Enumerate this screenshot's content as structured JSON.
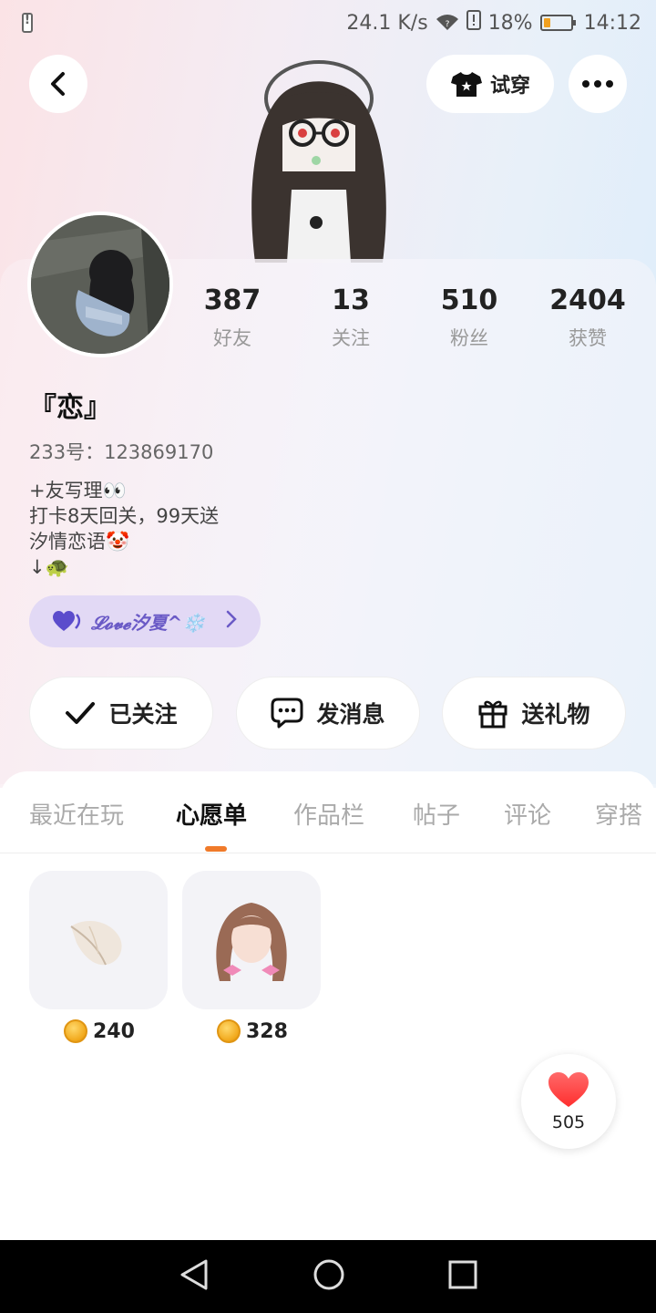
{
  "status_bar": {
    "net_speed": "24.1 K/s",
    "battery_percent": "18%",
    "time": "14:12"
  },
  "header": {
    "try_on_label": "试穿"
  },
  "profile": {
    "stats": [
      {
        "value": "387",
        "label": "好友"
      },
      {
        "value": "13",
        "label": "关注"
      },
      {
        "value": "510",
        "label": "粉丝"
      },
      {
        "value": "2404",
        "label": "获赞"
      }
    ],
    "nickname": "『恋』",
    "uid": "233号：123869170",
    "bio": [
      "+友写理👀",
      "打卡8天回关，99天送",
      "汐情恋语🤡",
      "↓🐢"
    ],
    "group_name": "𝓛𝓸𝓿𝓮汐夏^❄️"
  },
  "actions": {
    "follow_label": "已关注",
    "message_label": "发消息",
    "gift_label": "送礼物"
  },
  "tabs": [
    "最近在玩",
    "心愿单",
    "作品栏",
    "帖子",
    "评论",
    "穿搭"
  ],
  "active_tab": "心愿单",
  "wishlist": [
    {
      "item": "feather-item",
      "price": "240"
    },
    {
      "item": "hair-item",
      "price": "328"
    }
  ],
  "like_count": "505",
  "colors": {
    "accent": "#f07a2a",
    "group_pill": "#e2d9f5",
    "heart": "#ff3b3b"
  }
}
